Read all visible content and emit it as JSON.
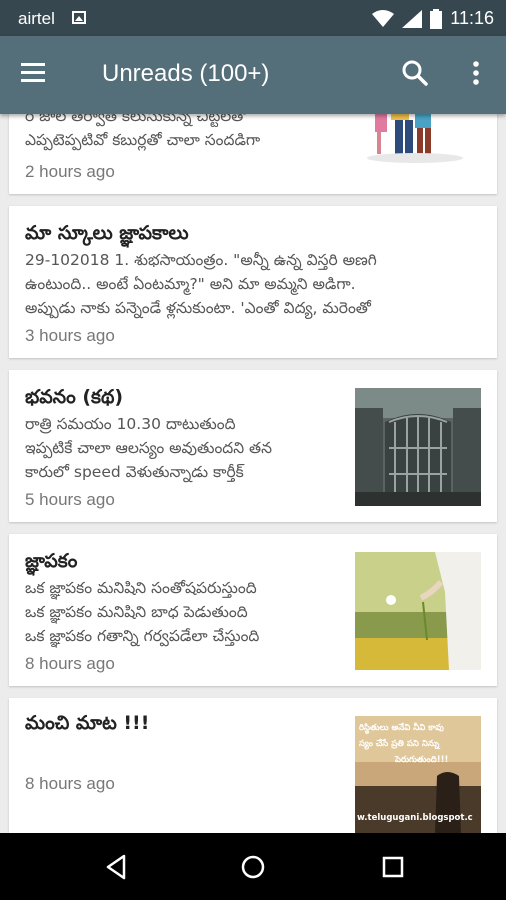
{
  "status_bar": {
    "carrier": "airtel",
    "time": "11:16"
  },
  "app_bar": {
    "title": "Unreads (100+)"
  },
  "posts": [
    {
      "title": "",
      "excerpt": "ర జాల తర్వాత కలుసుకున్న చిట్టిలతో\nఎప్పటెప్పటివో కబుర్లతో చాలా సందడిగా",
      "time": "2 hours ago"
    },
    {
      "title": "మా స్కూలు జ్ఞాపకాలు",
      "excerpt": "29-102018 1.  శుభసాయంత్రం. \"అన్నీ ఉన్న విస్తరి అణగి\nఉంటుంది.. అంటే ఏంటమ్మా?\" అని మా అమ్మని అడిగా.\nఅప్పుడు నాకు పన్నెండే ళ్లనుకుంటా. 'ఎంతో విద్య, మరెంతో",
      "time": "3 hours ago"
    },
    {
      "title": "భవనం (కథ)",
      "excerpt": "రాత్రి సమయం 10.30 దాటుతుంది\nఇప్పటికే చాలా ఆలస్యం అవుతుందని తన\nకారులో speed వెళుతున్నాడు కార్తీక్",
      "time": "5 hours ago"
    },
    {
      "title": "జ్ఞాపకం",
      "excerpt": "ఒక జ్ఞాపకం మనిషిని సంతోషపరుస్తుంది\nఒక జ్ఞాపకం మనిషిని బాధ పెడుతుంది\n ఒక జ్ఞాపకం గతాన్ని గర్వపడేలా చేస్తుంది",
      "time": "8 hours ago"
    },
    {
      "title": "మంచి మాట !!!",
      "excerpt": "",
      "time": "8 hours ago",
      "thumb_text": [
        "రిస్థితులు అనేవి నీవి కావు",
        "స్యం చేసే ప్రతి పని నిన్ను",
        "పెరుగుతుంది!!!",
        "w.telugugani.blogspot.c"
      ]
    }
  ],
  "icons": {
    "menu": "menu-icon",
    "search": "search-icon",
    "more": "more-vert-icon",
    "back": "back-triangle-icon",
    "home": "home-circle-icon",
    "recents": "recents-square-icon"
  },
  "colors": {
    "status_bar": "#37474f",
    "app_bar": "#546e7a",
    "background": "#ececec"
  }
}
